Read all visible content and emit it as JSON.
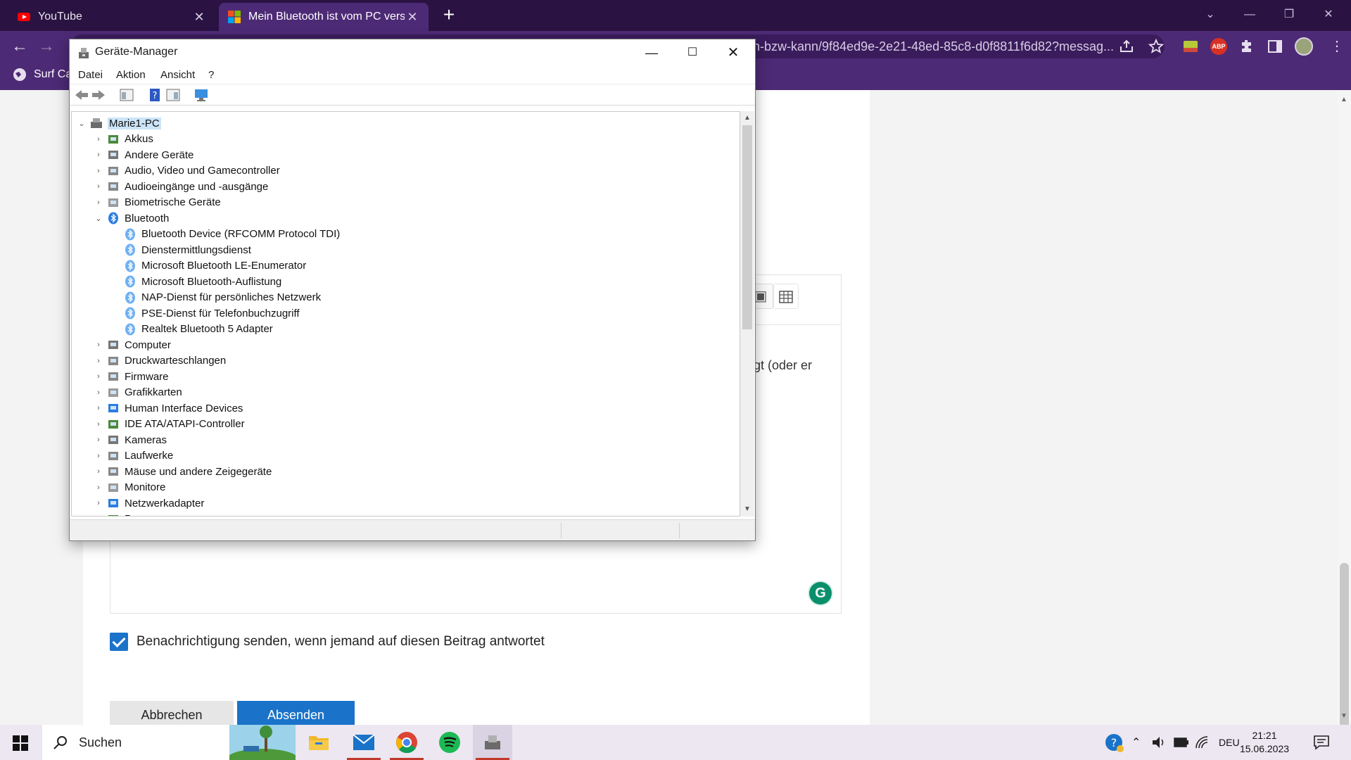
{
  "browser": {
    "tabs": [
      {
        "title": "YouTube",
        "active": false
      },
      {
        "title": "Mein Bluetooth ist vom PC verschwunden",
        "active": true
      }
    ],
    "url": "n-bzw-kann/9f84ed9e-2e21-48ed-85c8-d0f8811f6d82?messag...",
    "bookmark": "Surf Car",
    "ext_abp": "ABP"
  },
  "page": {
    "snippet": "eigt (oder er",
    "notify_label": "Benachrichtigung senden, wenn jemand auf diesen Beitrag antwortet",
    "notify_checked": true,
    "cancel_label": "Abbrechen",
    "send_label": "Absenden",
    "grammarly_letter": "G"
  },
  "device_manager": {
    "title": "Geräte-Manager",
    "menu": [
      "Datei",
      "Aktion",
      "Ansicht",
      "?"
    ],
    "root": "Marie1-PC",
    "tree": [
      {
        "label": "Akkus",
        "level": 1,
        "expanded": false
      },
      {
        "label": "Andere Geräte",
        "level": 1,
        "expanded": false
      },
      {
        "label": "Audio, Video und Gamecontroller",
        "level": 1,
        "expanded": false
      },
      {
        "label": "Audioeingänge und -ausgänge",
        "level": 1,
        "expanded": false
      },
      {
        "label": "Biometrische Geräte",
        "level": 1,
        "expanded": false
      },
      {
        "label": "Bluetooth",
        "level": 1,
        "expanded": true
      },
      {
        "label": "Bluetooth Device (RFCOMM Protocol TDI)",
        "level": 2
      },
      {
        "label": "Dienstermittlungsdienst",
        "level": 2
      },
      {
        "label": "Microsoft Bluetooth LE-Enumerator",
        "level": 2
      },
      {
        "label": "Microsoft Bluetooth-Auflistung",
        "level": 2
      },
      {
        "label": "NAP-Dienst für persönliches Netzwerk",
        "level": 2
      },
      {
        "label": "PSE-Dienst für Telefonbuchzugriff",
        "level": 2
      },
      {
        "label": "Realtek Bluetooth 5 Adapter",
        "level": 2
      },
      {
        "label": "Computer",
        "level": 1,
        "expanded": false
      },
      {
        "label": "Druckwarteschlangen",
        "level": 1,
        "expanded": false
      },
      {
        "label": "Firmware",
        "level": 1,
        "expanded": false
      },
      {
        "label": "Grafikkarten",
        "level": 1,
        "expanded": false
      },
      {
        "label": "Human Interface Devices",
        "level": 1,
        "expanded": false
      },
      {
        "label": "IDE ATA/ATAPI-Controller",
        "level": 1,
        "expanded": false
      },
      {
        "label": "Kameras",
        "level": 1,
        "expanded": false
      },
      {
        "label": "Laufwerke",
        "level": 1,
        "expanded": false
      },
      {
        "label": "Mäuse und andere Zeigegeräte",
        "level": 1,
        "expanded": false
      },
      {
        "label": "Monitore",
        "level": 1,
        "expanded": false
      },
      {
        "label": "Netzwerkadapter",
        "level": 1,
        "expanded": false
      },
      {
        "label": "Prozessoren",
        "level": 1,
        "expanded": false
      }
    ]
  },
  "taskbar": {
    "search_placeholder": "Suchen",
    "language": "DEU",
    "time": "21:21",
    "date": "15.06.2023"
  },
  "colors": {
    "browser_tabbar": "#2a1342",
    "browser_toolbar": "#4d2a75",
    "accent_blue": "#1a73c9",
    "bluetooth_blue": "#2b7de0"
  }
}
